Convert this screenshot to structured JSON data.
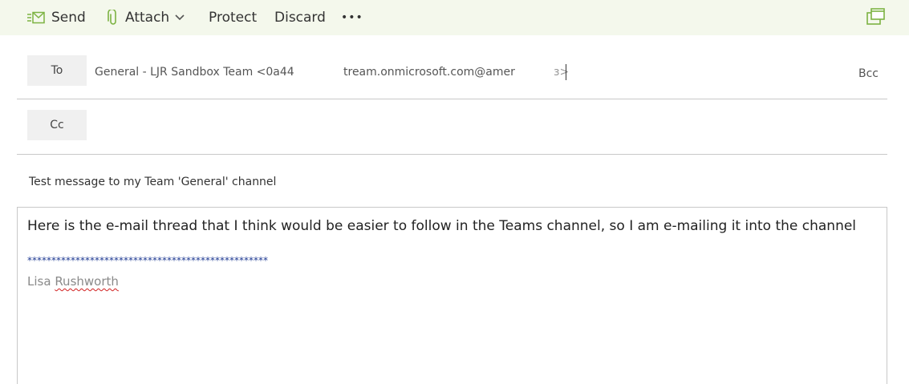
{
  "toolbar": {
    "send_label": "Send",
    "attach_label": "Attach",
    "protect_label": "Protect",
    "discard_label": "Discard",
    "more_label": "•••"
  },
  "recipients": {
    "to_label": "To",
    "to_value_part1": "General - LJR Sandbox Team <0a44",
    "to_value_part2": "tream.onmicrosoft.com@amer",
    "to_value_part3": "ɜ>",
    "cc_label": "Cc",
    "bcc_label": "Bcc"
  },
  "subject": "Test message to my Team 'General' channel",
  "body": {
    "text": "Here is the e-mail thread that I think would be easier to follow in the Teams channel, so I am e-mailing it into the channel",
    "separator": "**************************************************",
    "signature_first": "Lisa",
    "signature_last": "Rushworth"
  },
  "colors": {
    "toolbar_bg": "#f4f8ec",
    "accent_green": "#7cb342"
  }
}
